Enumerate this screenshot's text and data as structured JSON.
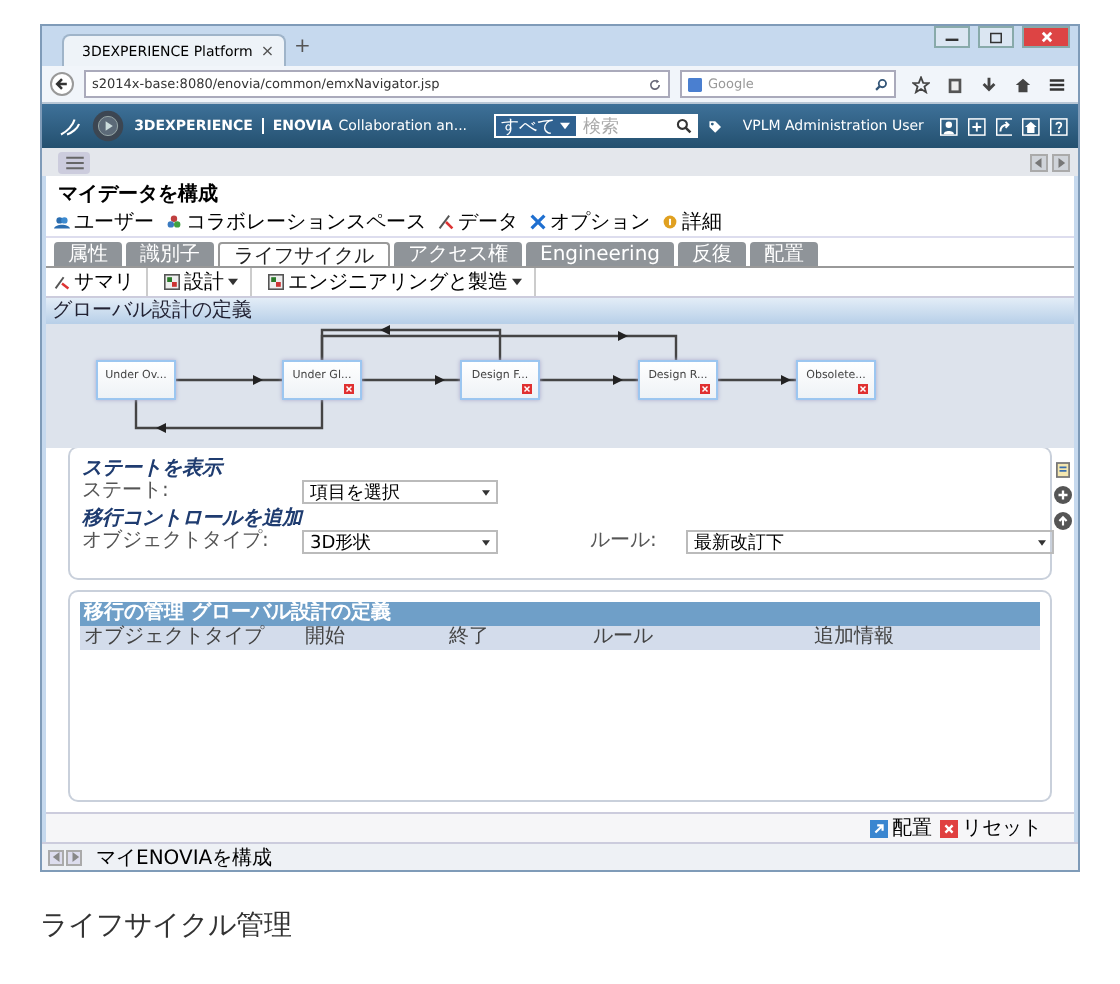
{
  "browser": {
    "tab_title": "3DEXPERIENCE Platform",
    "tab_close": "×",
    "new_tab": "+",
    "url": "s2014x-base:8080/enovia/common/emxNavigator.jsp",
    "search_placeholder": "Google"
  },
  "app_bar": {
    "brand": "3DEXPERIENCE",
    "app_name": "ENOVIA",
    "app_title": "Collaboration an...",
    "search_scope": "すべて",
    "search_placeholder": "検索",
    "user": "VPLM Administration User"
  },
  "page_title": "マイデータを構成",
  "commands": [
    {
      "label": "ユーザー"
    },
    {
      "label": "コラボレーションスペース"
    },
    {
      "label": "データ"
    },
    {
      "label": "オプション"
    },
    {
      "label": "詳細"
    }
  ],
  "tabs": [
    {
      "label": "属性",
      "selected": false
    },
    {
      "label": "識別子",
      "selected": false
    },
    {
      "label": "ライフサイクル",
      "selected": true
    },
    {
      "label": "アクセス権",
      "selected": false
    },
    {
      "label": "Engineering",
      "selected": false
    },
    {
      "label": "反復",
      "selected": false
    },
    {
      "label": "配置",
      "selected": false
    }
  ],
  "toolbar": [
    {
      "label": "サマリ",
      "dropdown": false
    },
    {
      "label": "設計",
      "dropdown": true
    },
    {
      "label": "エンジニアリングと製造",
      "dropdown": true
    }
  ],
  "section_title": "グローバル設計の定義",
  "states": [
    {
      "label": "Under Ov...",
      "deletable": false
    },
    {
      "label": "Under Gl...",
      "deletable": true
    },
    {
      "label": "Design F...",
      "deletable": true
    },
    {
      "label": "Design R...",
      "deletable": true
    },
    {
      "label": "Obsolete...",
      "deletable": true
    }
  ],
  "state_form": {
    "heading": "ステートを表示",
    "label": "ステート:",
    "value": "項目を選択"
  },
  "transition_form": {
    "heading": "移行コントロールを追加",
    "type_label": "オブジェクトタイプ:",
    "type_value": "3D形状",
    "rule_label": "ルール:",
    "rule_value": "最新改訂下"
  },
  "table": {
    "title": "移行の管理 グローバル設計の定義",
    "columns": [
      "オブジェクトタイプ",
      "開始",
      "終了",
      "ルール",
      "追加情報"
    ]
  },
  "footer_buttons": [
    "配置",
    "リセット"
  ],
  "status_bar": "マイENOVIAを構成",
  "caption": "ライフサイクル管理"
}
